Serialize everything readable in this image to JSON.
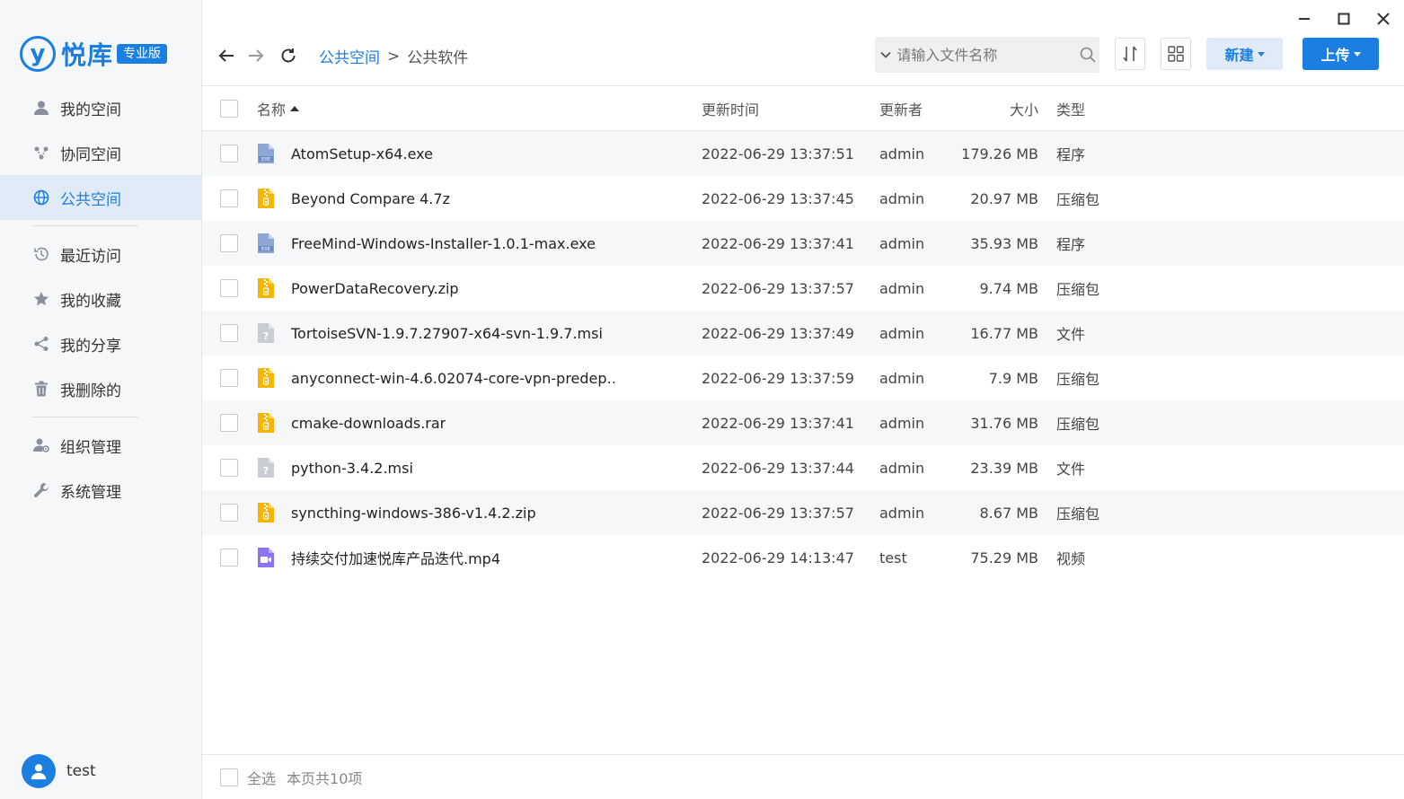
{
  "app": {
    "logo_mark": "y",
    "name": "悦库",
    "edition_badge": "专业版",
    "brand_color": "#1a7fe0"
  },
  "sidebar": {
    "groups": [
      [
        {
          "label": "我的空间",
          "icon": "user-icon"
        },
        {
          "label": "协同空间",
          "icon": "collab-icon"
        },
        {
          "label": "公共空间",
          "icon": "globe-icon",
          "active": true
        }
      ],
      [
        {
          "label": "最近访问",
          "icon": "history-icon"
        },
        {
          "label": "我的收藏",
          "icon": "star-icon"
        },
        {
          "label": "我的分享",
          "icon": "share-icon"
        },
        {
          "label": "我删除的",
          "icon": "trash-icon"
        }
      ],
      [
        {
          "label": "组织管理",
          "icon": "org-icon"
        },
        {
          "label": "系统管理",
          "icon": "wrench-icon"
        }
      ]
    ],
    "user": {
      "name": "test"
    }
  },
  "toolbar": {
    "breadcrumb": {
      "parent": "公共空间",
      "separator": ">",
      "current": "公共软件"
    },
    "search": {
      "placeholder": "请输入文件名称",
      "value": ""
    },
    "new_label": "新建",
    "upload_label": "上传"
  },
  "table": {
    "headers": {
      "name": "名称",
      "time": "更新时间",
      "user": "更新者",
      "size": "大小",
      "type": "类型"
    },
    "rows": [
      {
        "name": "AtomSetup-x64.exe",
        "time": "2022-06-29 13:37:51",
        "user": "admin",
        "size": "179.26 MB",
        "type": "程序",
        "icon": "exe"
      },
      {
        "name": "Beyond Compare 4.7z",
        "time": "2022-06-29 13:37:45",
        "user": "admin",
        "size": "20.97 MB",
        "type": "压缩包",
        "icon": "zip"
      },
      {
        "name": "FreeMind-Windows-Installer-1.0.1-max.exe",
        "time": "2022-06-29 13:37:41",
        "user": "admin",
        "size": "35.93 MB",
        "type": "程序",
        "icon": "exe"
      },
      {
        "name": "PowerDataRecovery.zip",
        "time": "2022-06-29 13:37:57",
        "user": "admin",
        "size": "9.74 MB",
        "type": "压缩包",
        "icon": "zip"
      },
      {
        "name": "TortoiseSVN-1.9.7.27907-x64-svn-1.9.7.msi",
        "time": "2022-06-29 13:37:49",
        "user": "admin",
        "size": "16.77 MB",
        "type": "文件",
        "icon": "unknown"
      },
      {
        "name": "anyconnect-win-4.6.02074-core-vpn-predep…",
        "time": "2022-06-29 13:37:59",
        "user": "admin",
        "size": "7.9 MB",
        "type": "压缩包",
        "icon": "zip"
      },
      {
        "name": "cmake-downloads.rar",
        "time": "2022-06-29 13:37:41",
        "user": "admin",
        "size": "31.76 MB",
        "type": "压缩包",
        "icon": "zip"
      },
      {
        "name": "python-3.4.2.msi",
        "time": "2022-06-29 13:37:44",
        "user": "admin",
        "size": "23.39 MB",
        "type": "文件",
        "icon": "unknown"
      },
      {
        "name": "syncthing-windows-386-v1.4.2.zip",
        "time": "2022-06-29 13:37:57",
        "user": "admin",
        "size": "8.67 MB",
        "type": "压缩包",
        "icon": "zip"
      },
      {
        "name": "持续交付加速悦库产品迭代.mp4",
        "time": "2022-06-29 14:13:47",
        "user": "test",
        "size": "75.29 MB",
        "type": "视频",
        "icon": "video"
      }
    ]
  },
  "footer": {
    "select_all": "全选",
    "count": "本页共10项"
  }
}
